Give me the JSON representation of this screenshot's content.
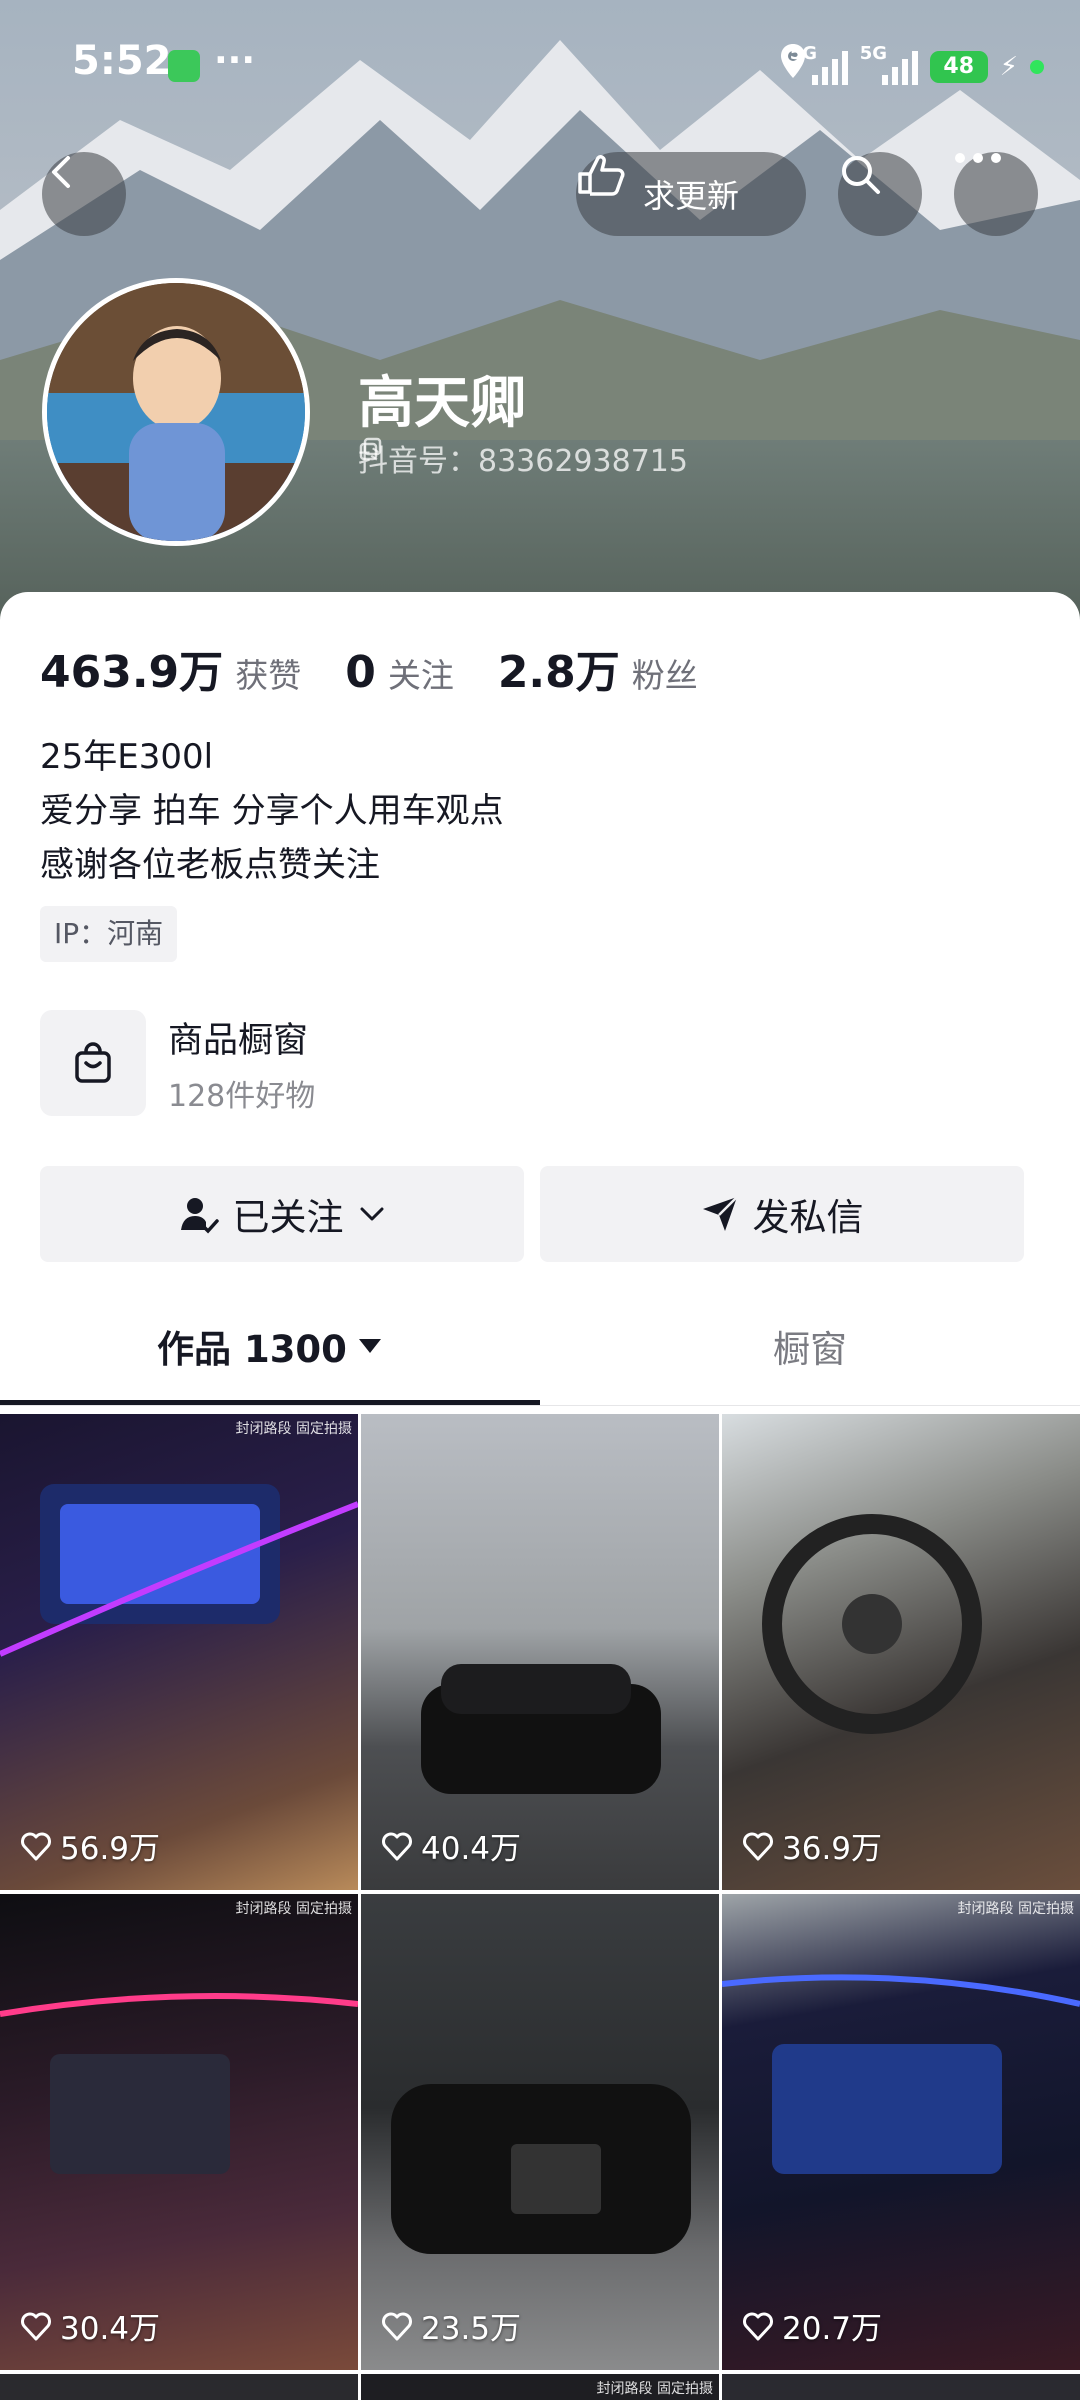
{
  "status_bar": {
    "time": "5:52",
    "dots": "···",
    "signal_1": "5G",
    "signal_2": "5G",
    "battery": "48"
  },
  "header": {
    "request_update_label": "求更新",
    "icons": [
      "back-icon",
      "hand-icon",
      "search-icon",
      "more-icon"
    ]
  },
  "profile": {
    "name": "高天卿",
    "douyin_id": "抖音号：83362938715",
    "stats": [
      {
        "num": "463.9万",
        "label": "获赞"
      },
      {
        "num": "0",
        "label": "关注"
      },
      {
        "num": "2.8万",
        "label": "粉丝"
      }
    ],
    "bio": [
      "25年E300l",
      "爱分享 拍车 分享个人用车观点",
      "感谢各位老板点赞关注"
    ],
    "ip": "IP：河南"
  },
  "shop": {
    "title": "商品橱窗",
    "subtitle": "128件好物"
  },
  "actions": {
    "followed_label": "已关注",
    "message_label": "发私信"
  },
  "tabs": {
    "works_label": "作品 1300",
    "window_label": "橱窗"
  },
  "videos": [
    {
      "likes": "56.9万",
      "watermark": "封闭路段 固定拍摄"
    },
    {
      "likes": "40.4万",
      "watermark": ""
    },
    {
      "likes": "36.9万",
      "watermark": ""
    },
    {
      "likes": "30.4万",
      "watermark": "封闭路段 固定拍摄"
    },
    {
      "likes": "23.5万",
      "watermark": ""
    },
    {
      "likes": "20.7万",
      "watermark": "封闭路段 固定拍摄"
    },
    {
      "likes": "",
      "watermark": ""
    },
    {
      "likes": "",
      "watermark": "封闭路段 固定拍摄"
    },
    {
      "likes": "",
      "watermark": ""
    }
  ],
  "colors": {
    "accent_green": "#31c54f",
    "text_primary": "#161823",
    "text_secondary": "#6f7079",
    "button_bg": "#f2f2f4"
  }
}
